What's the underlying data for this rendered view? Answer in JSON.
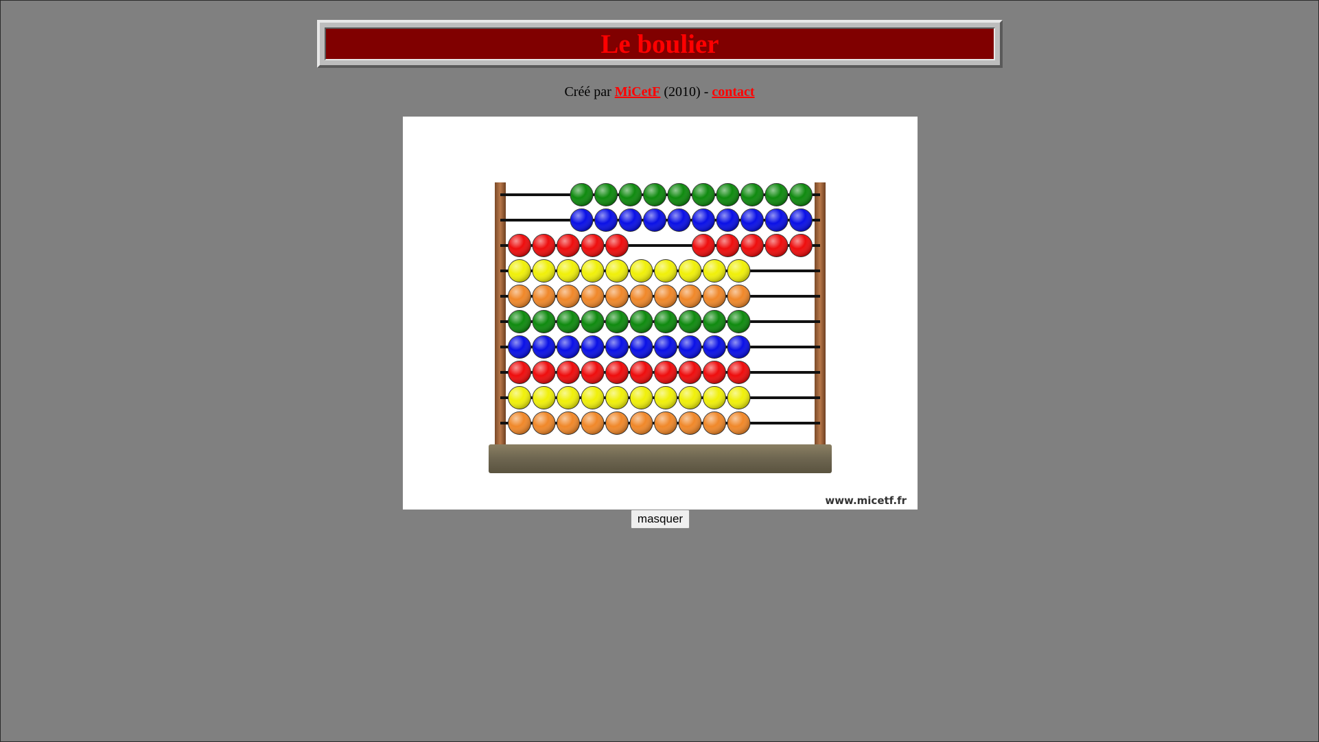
{
  "header": {
    "title": "Le boulier"
  },
  "credit": {
    "prefix": "Créé par",
    "author_link": "MiCetF",
    "middle": "(2010) -",
    "contact_link": "contact"
  },
  "abacus": {
    "watermark": "www.micetf.fr",
    "rows": [
      {
        "color": "#0f8a0f",
        "left_count": 0,
        "right_count": 10
      },
      {
        "color": "#0a10e6",
        "left_count": 0,
        "right_count": 10
      },
      {
        "color": "#ee0d0d",
        "left_count": 5,
        "right_count": 5
      },
      {
        "color": "#f0f00a",
        "left_count": 10,
        "right_count": 0
      },
      {
        "color": "#f0882a",
        "left_count": 10,
        "right_count": 0
      },
      {
        "color": "#0f8a0f",
        "left_count": 10,
        "right_count": 0
      },
      {
        "color": "#0a10e6",
        "left_count": 10,
        "right_count": 0
      },
      {
        "color": "#ee0d0d",
        "left_count": 10,
        "right_count": 0
      },
      {
        "color": "#f0f00a",
        "left_count": 10,
        "right_count": 0
      },
      {
        "color": "#f0882a",
        "left_count": 10,
        "right_count": 0
      }
    ]
  },
  "controls": {
    "hide_button": "masquer"
  }
}
